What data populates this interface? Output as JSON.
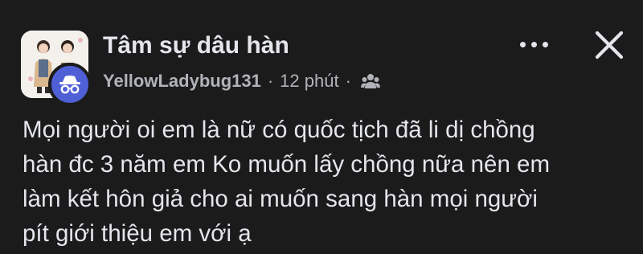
{
  "post": {
    "group_name": "Tâm sự dâu hàn",
    "author": "YellowLadybug131",
    "time": "12 phút",
    "separator": "·",
    "audience_icon": "group-icon",
    "group_avatar_icon": "couple-illustration-icon",
    "anonymous_icon": "anonymous-member-icon",
    "more_icon": "more-horizontal-icon",
    "close_icon": "close-icon",
    "body_text": "Mọi người oi em là nữ có quốc tịch đã li dị chồng\nhàn đc 3 năm em Ko muốn lấy chồng nữa nên em\nlàm kết hôn giả cho ai muốn sang hàn mọi người\npít giới thiệu em với ạ"
  },
  "colors": {
    "background": "#1b1b1c",
    "primary_text": "#e4e6eb",
    "secondary_text": "#b0b3b8",
    "badge": "#4f5fd6"
  }
}
